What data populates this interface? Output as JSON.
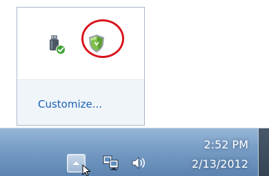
{
  "flyout": {
    "customize_label": "Customize...",
    "icons": [
      {
        "name": "usb-safely-remove-icon",
        "tooltip": ""
      },
      {
        "name": "security-shield-icon",
        "tooltip": ""
      }
    ]
  },
  "highlight": {
    "color": "#d8141c"
  },
  "taskbar": {
    "tray_icons": [
      "show-hidden-icons-arrow",
      "network-icon",
      "volume-icon"
    ],
    "clock": {
      "time": "2:52 PM",
      "date": "2/13/2012"
    }
  },
  "colors": {
    "link": "#1a5fb4",
    "flyout_border": "#a9b6c6",
    "customize_bg": "#f0f5fa",
    "taskbar_top": "#98b7d6",
    "taskbar_bottom": "#5d84b0",
    "shield_green": "#7fc24a"
  }
}
